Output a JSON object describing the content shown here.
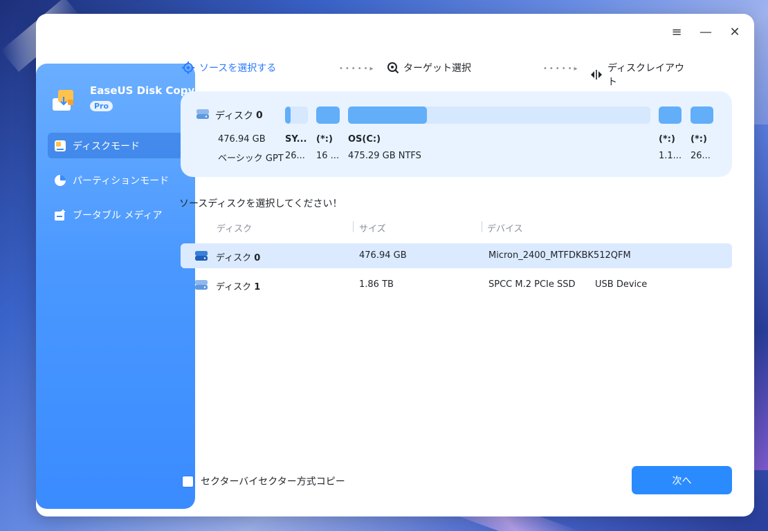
{
  "app": {
    "name": "EaseUS Disk Copy",
    "badge": "Pro"
  },
  "sidebar": {
    "items": [
      {
        "label": "ディスクモード",
        "icon": "disk-mode-icon",
        "active": true
      },
      {
        "label": "パーティションモード",
        "icon": "pie-chart-icon",
        "active": false
      },
      {
        "label": "ブータブル メディア",
        "icon": "bootable-media-icon",
        "active": false
      }
    ]
  },
  "window_controls": {
    "menu": "≡",
    "minimize": "—",
    "close": "✕"
  },
  "steps": [
    {
      "label": "ソースを選択する",
      "state": "active"
    },
    {
      "label": "ターゲット選択",
      "state": "pending"
    },
    {
      "label": "ディスクレイアウト",
      "state": "pending"
    }
  ],
  "step_dots": "•••••▸",
  "disk_card": {
    "name_prefix": "ディスク",
    "name_num": "0",
    "size": "476.94 GB",
    "type": "ベーシック GPT",
    "partitions": [
      {
        "name": "SY...",
        "size": "26...",
        "fill": 0.25
      },
      {
        "name": "(*:)",
        "size": "16 ...",
        "fill": 1.0
      },
      {
        "name": "OS(C:)",
        "size": "475.29 GB NTFS",
        "fill": 0.26
      },
      {
        "name": "(*:)",
        "size": "1.1...",
        "fill": 1.0
      },
      {
        "name": "(*:)",
        "size": "26...",
        "fill": 1.0
      }
    ]
  },
  "prompt": "ソースディスクを選択してください！",
  "table": {
    "headers": [
      "ディスク",
      "サイズ",
      "デバイス"
    ],
    "rows": [
      {
        "disk_prefix": "ディスク",
        "disk_num": "0",
        "size": "476.94 GB",
        "device": "Micron_2400_MTFDKBK512QFM",
        "device_extra": "",
        "selected": true
      },
      {
        "disk_prefix": "ディスク",
        "disk_num": "1",
        "size": "1.86 TB",
        "device": "SPCC M.2  PCIe SSD",
        "device_extra": "USB Device",
        "selected": false
      }
    ]
  },
  "footer": {
    "checkbox_label": "セクターバイセクター方式コピー",
    "next_button": "次へ"
  },
  "colors": {
    "accent": "#2a8bff",
    "partition_fill": "#62aef8",
    "partition_track": "#d6e8fd",
    "card_bg": "#e8f3ff",
    "selected_row": "#dbeafe"
  }
}
